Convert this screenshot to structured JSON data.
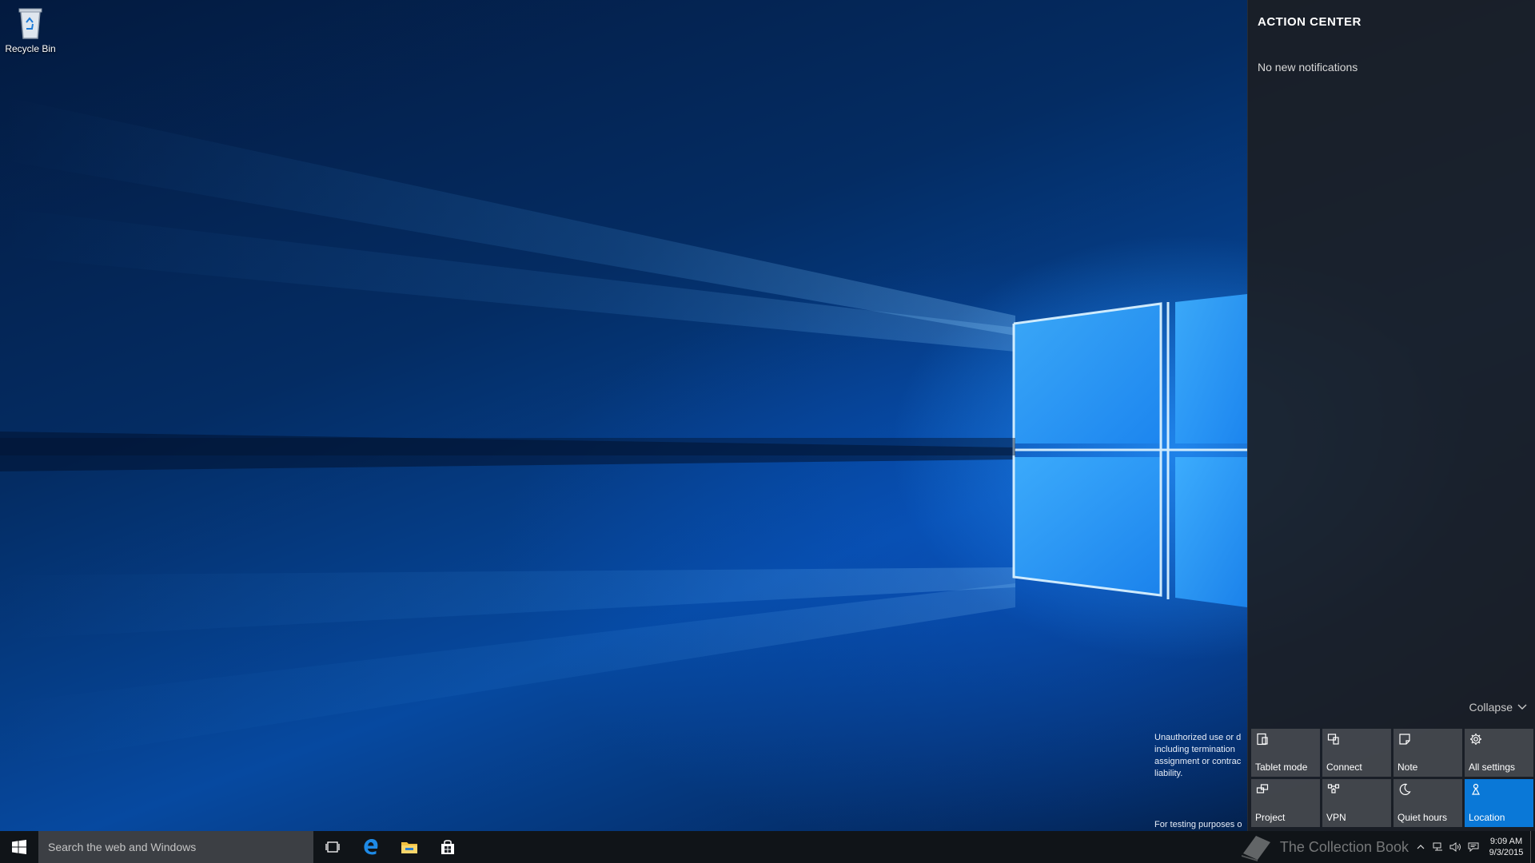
{
  "desktop": {
    "icons": [
      {
        "label": "Recycle Bin",
        "icon": "recycle-bin-icon"
      }
    ],
    "legal_notice": {
      "lines": [
        "Unauthorized use or d",
        "including termination",
        "assignment or contrac",
        "liability."
      ],
      "footer": "For testing purposes o"
    }
  },
  "action_center": {
    "title": "ACTION CENTER",
    "empty_message": "No new notifications",
    "collapse_label": "Collapse",
    "quick_actions": [
      {
        "label": "Tablet mode",
        "icon": "tablet-mode-icon",
        "active": false
      },
      {
        "label": "Connect",
        "icon": "connect-icon",
        "active": false
      },
      {
        "label": "Note",
        "icon": "note-icon",
        "active": false
      },
      {
        "label": "All settings",
        "icon": "gear-icon",
        "active": false
      },
      {
        "label": "Project",
        "icon": "project-icon",
        "active": false
      },
      {
        "label": "VPN",
        "icon": "vpn-icon",
        "active": false
      },
      {
        "label": "Quiet hours",
        "icon": "moon-icon",
        "active": false
      },
      {
        "label": "Location",
        "icon": "location-icon",
        "active": true
      }
    ],
    "active_color": "#0a78d7"
  },
  "taskbar": {
    "search_placeholder": "Search the web and Windows",
    "pinned": [
      "task-view-icon",
      "edge-icon",
      "file-explorer-icon",
      "store-icon"
    ],
    "watermark": "The Collection Book",
    "clock": {
      "time": "9:09 AM",
      "date": "9/3/2015"
    }
  },
  "colors": {
    "taskbar": "#101418",
    "search_box": "#3c3f44",
    "accent": "#0a78d7"
  }
}
